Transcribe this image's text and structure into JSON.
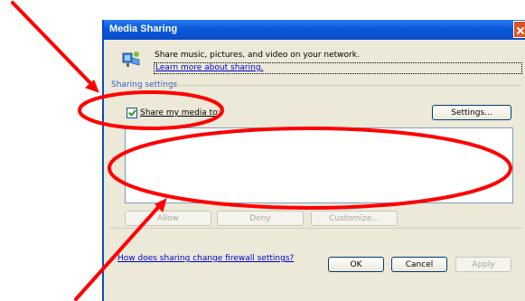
{
  "window": {
    "title": "Media Sharing"
  },
  "info": {
    "description": "Share music, pictures, and video on your network.",
    "learn_more_link": "Learn more about sharing."
  },
  "sharing_settings": {
    "group_label": "Sharing settings",
    "share_checkbox_label": "Share my media to:",
    "share_checked": true,
    "settings_button": "Settings...",
    "allow_button": "Allow",
    "deny_button": "Deny",
    "customize_button": "Customize..."
  },
  "footer": {
    "firewall_link": "How does sharing change firewall settings?",
    "ok_button": "OK",
    "cancel_button": "Cancel",
    "apply_button": "Apply"
  },
  "annotation": {
    "color": "#ff0000"
  }
}
